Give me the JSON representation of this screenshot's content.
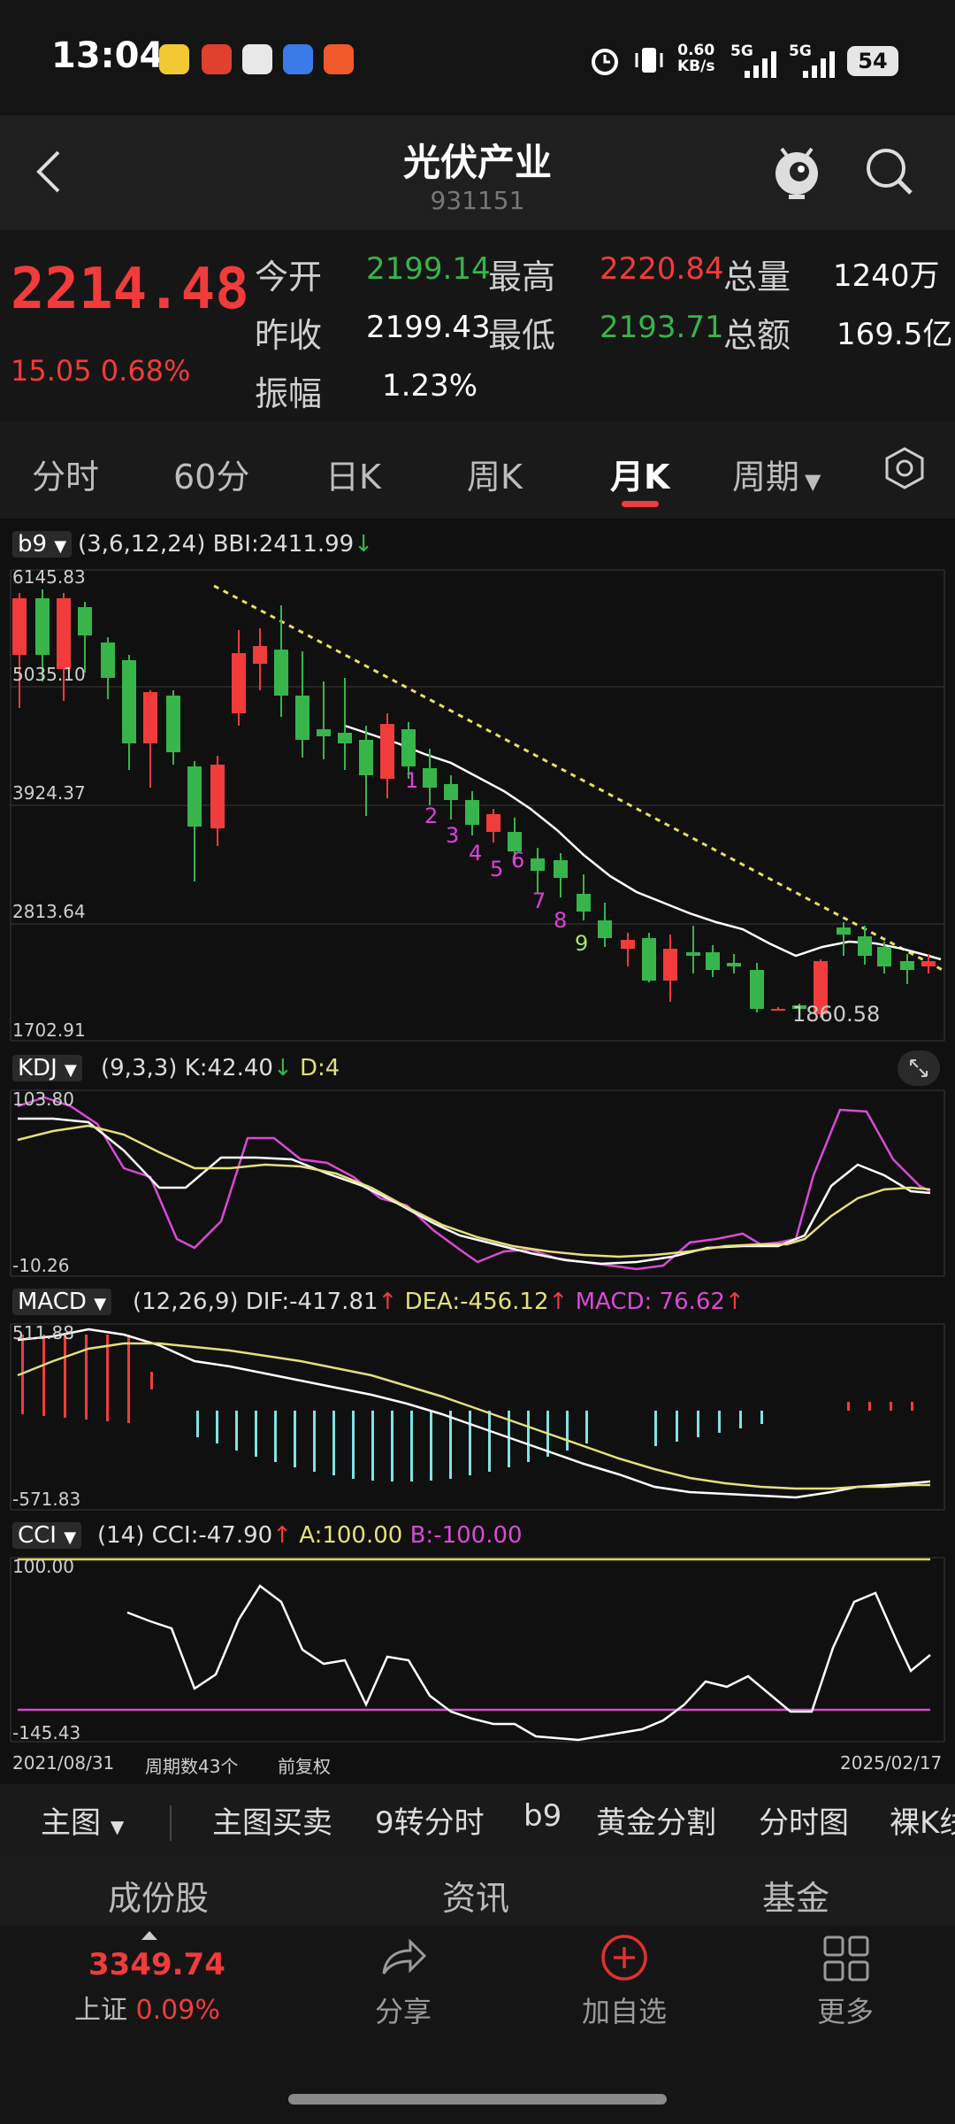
{
  "status_bar": {
    "time": "13:04",
    "net_speed": "0.60",
    "net_unit": "KB/s",
    "sim1": "5G",
    "sim2": "5G",
    "battery": "54"
  },
  "header": {
    "title": "光伏产业",
    "code": "931151"
  },
  "quote": {
    "price": "2214.48",
    "change": "15.05 0.68%",
    "open_label": "今开",
    "open": "2199.14",
    "high_label": "最高",
    "high": "2220.84",
    "volume_label": "总量",
    "volume": "1240万",
    "prev_close_label": "昨收",
    "prev_close": "2199.43",
    "low_label": "最低",
    "low": "2193.71",
    "amount_label": "总额",
    "amount": "169.5亿",
    "amplitude_label": "振幅",
    "amplitude": "1.23%"
  },
  "tabs": [
    "分时",
    "60分",
    "日K",
    "周K",
    "月K",
    "周期"
  ],
  "active_tab": "月K",
  "main_chart": {
    "indicator_name": "b9",
    "params": "(3,6,12,24) BBI:2411.99",
    "y_ticks": [
      "6145.83",
      "5035.10",
      "3924.37",
      "2813.64",
      "1702.91"
    ],
    "low_label": "1860.58",
    "nine_turn": [
      "1",
      "2",
      "3",
      "4",
      "5",
      "6",
      "7",
      "8",
      "9"
    ]
  },
  "kdj": {
    "name": "KDJ",
    "params": "(9,3,3) K:42.40",
    "d": "D:4",
    "y_top": "103.80",
    "y_bottom": "-10.26"
  },
  "macd": {
    "name": "MACD",
    "params": "(12,26,9) DIF:-417.81",
    "dea": "DEA:-456.12",
    "macd": "MACD: 76.62",
    "y_top": "511.88",
    "y_bottom": "-571.83"
  },
  "cci": {
    "name": "CCI",
    "params": "(14) CCI:-47.90",
    "a": "A:100.00",
    "b": "B:-100.00",
    "y_top": "100.00",
    "y_bottom": "-145.43"
  },
  "chart_footer": {
    "start_date": "2021/08/31",
    "period_count": "周期数43个",
    "adjust": "前复权",
    "end_date": "2025/02/17"
  },
  "toolbar": [
    "主图",
    "主图买卖",
    "9转分时",
    "b9",
    "黄金分割",
    "分时图",
    "裸K线"
  ],
  "segments": [
    "成份股",
    "资讯",
    "基金"
  ],
  "bottom_nav": {
    "index_value": "3349.74",
    "index_name": "上证",
    "index_change": "0.09%",
    "share": "分享",
    "add": "加自选",
    "more": "更多"
  },
  "colors": {
    "up": "#f23b3b",
    "down": "#37b54a",
    "bbi_line": "#ffffff",
    "trend_line": "#e8e05a",
    "kdj_j": "#d94ad6",
    "dea": "#e3e07a",
    "macd_neg": "#7fe3e3",
    "cci_a": "#d9d94a",
    "cci_b": "#d94ad6"
  }
}
